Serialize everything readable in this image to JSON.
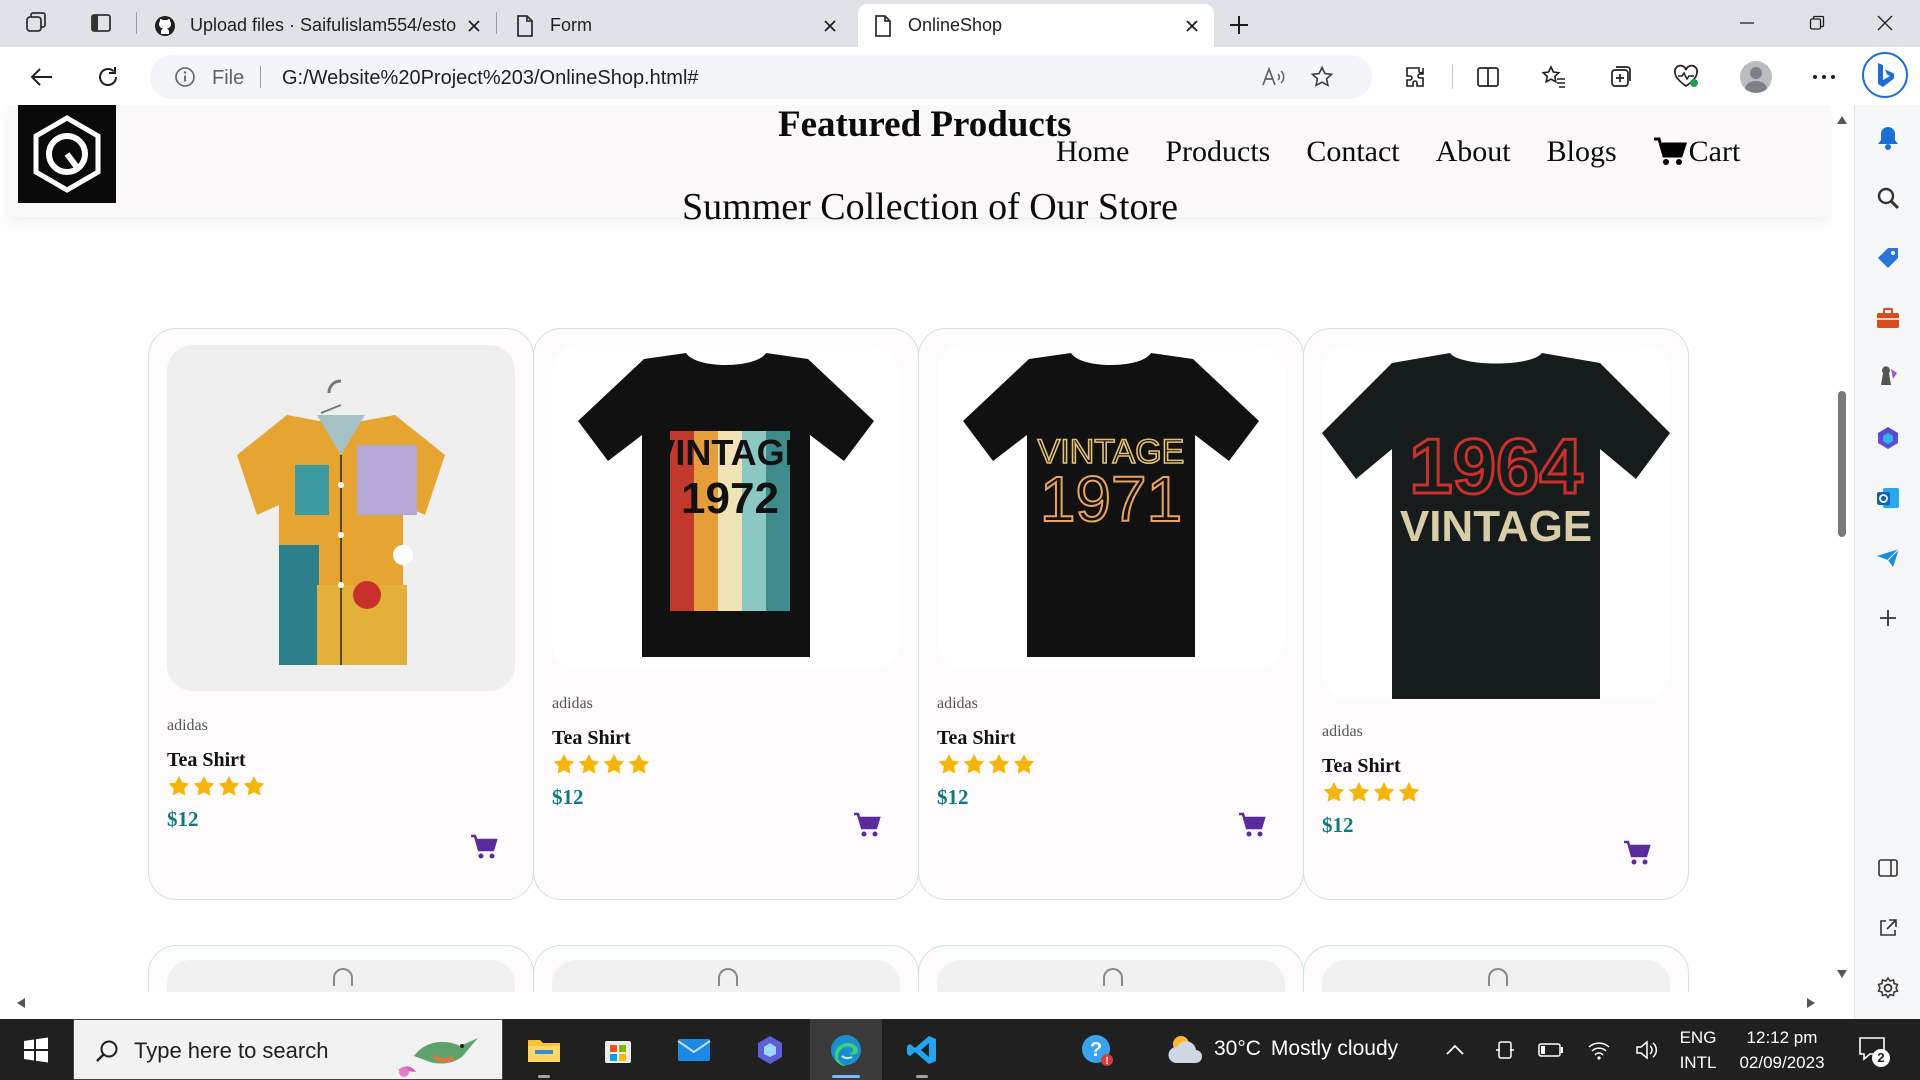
{
  "browser": {
    "tabs": [
      {
        "title": "Upload files · Saifulislam554/esto",
        "icon": "github-icon"
      },
      {
        "title": "Form",
        "icon": "page-icon"
      },
      {
        "title": "OnlineShop",
        "icon": "page-icon",
        "active": true
      }
    ],
    "address": {
      "scheme_label": "File",
      "url": "G:/Website%20Project%203/OnlineShop.html#"
    },
    "accent_color": "#1b6fd6"
  },
  "site": {
    "header": {
      "featured_title": "Featured Products",
      "nav": [
        "Home",
        "Products",
        "Contact",
        "About",
        "Blogs"
      ],
      "cart_label": "Cart",
      "collection_title": "Summer Collection of Our Store"
    },
    "products": [
      {
        "brand": "adidas",
        "name": "Tea Shirt",
        "price": "$12",
        "rating": 4,
        "image": "floral-shirt"
      },
      {
        "brand": "adidas",
        "name": "Tea Shirt",
        "price": "$12",
        "rating": 4,
        "image": "vintage-1972-tshirt",
        "print_top": "VINTAGE",
        "print_year": "1972"
      },
      {
        "brand": "adidas",
        "name": "Tea Shirt",
        "price": "$12",
        "rating": 4,
        "image": "vintage-1971-tshirt",
        "print_top": "VINTAGE",
        "print_year": "1971"
      },
      {
        "brand": "adidas",
        "name": "Tea Shirt",
        "price": "$12",
        "rating": 4,
        "image": "vintage-1964-tshirt",
        "print_year": "1964",
        "print_bottom": "VINTAGE"
      }
    ],
    "colors": {
      "price": "#0e7b7b",
      "cart_icon": "#5b2a9b",
      "star": "#f5b50a"
    }
  },
  "taskbar": {
    "search_placeholder": "Type here to search",
    "weather": {
      "temp": "30°C",
      "condition": "Mostly cloudy"
    },
    "language": {
      "line1": "ENG",
      "line2": "INTL"
    },
    "clock": {
      "time": "12:12 pm",
      "date": "02/09/2023"
    },
    "notification_count": "2"
  }
}
